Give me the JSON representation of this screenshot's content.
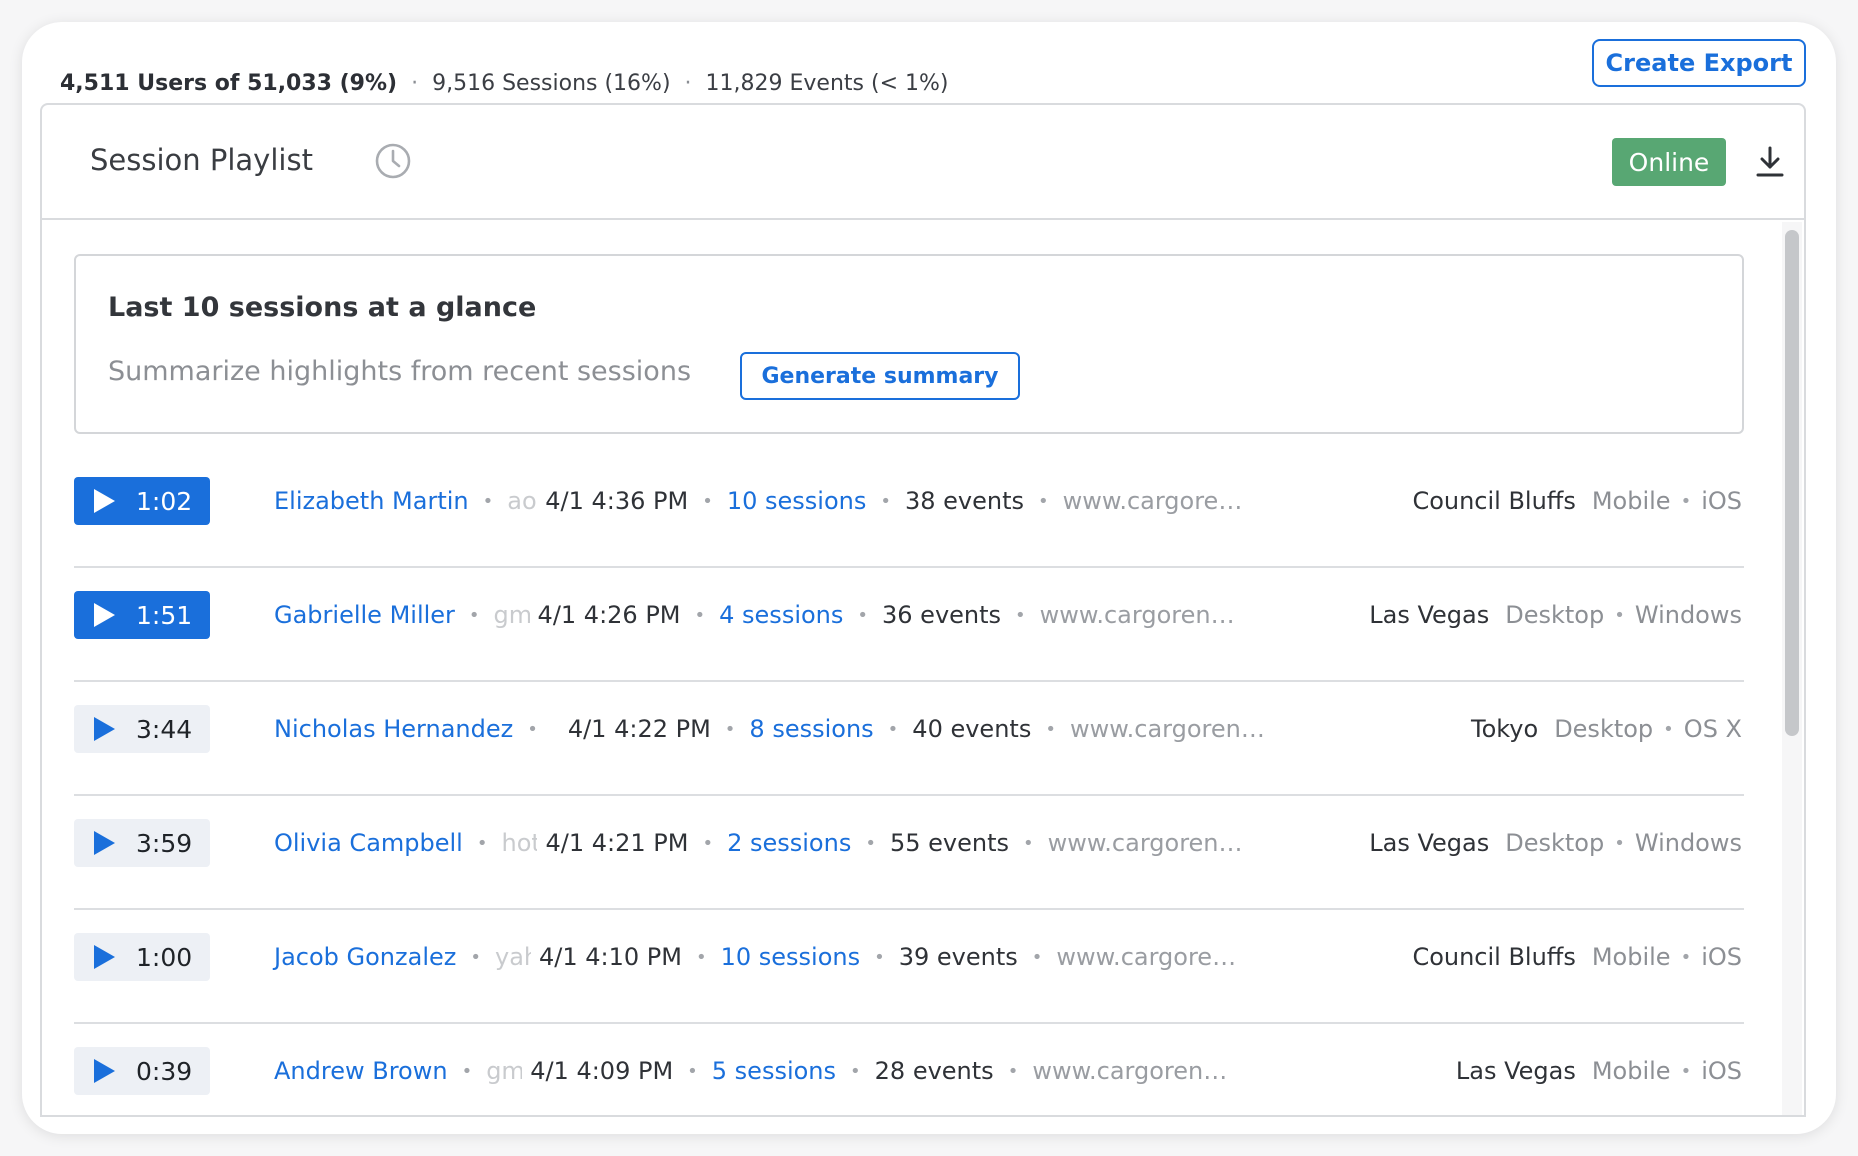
{
  "stats": {
    "users": "4,511 Users of 51,033 (9%)",
    "sessions": "9,516 Sessions (16%)",
    "events": "11,829 Events (< 1%)"
  },
  "toolbar": {
    "export_label": "Create Export"
  },
  "panel": {
    "title": "Session Playlist",
    "status": "Online",
    "status_color": "#58a773"
  },
  "summary": {
    "title": "Last 10 sessions at a glance",
    "description": "Summarize highlights from recent sessions",
    "button_label": "Generate summary"
  },
  "colors": {
    "accent": "#1a6fdb"
  },
  "icons": {
    "history": "clock-history-icon",
    "download": "download-icon",
    "play": "play-icon"
  },
  "sessions": [
    {
      "duration": "1:02",
      "user": "Elizabeth Martin",
      "email": "aol",
      "datetime": "4/1 4:36 PM",
      "sessions": "10 sessions",
      "events": "38 events",
      "url": "www.cargorent...",
      "city": "Council Bluffs",
      "device": "Mobile",
      "os": "iOS",
      "active": true
    },
    {
      "duration": "1:51",
      "user": "Gabrielle Miller",
      "email": "gmai",
      "datetime": "4/1 4:26 PM",
      "sessions": "4 sessions",
      "events": "36 events",
      "url": "www.cargorental...",
      "city": "Las Vegas",
      "device": "Desktop",
      "os": "Windows",
      "active": true
    },
    {
      "duration": "3:44",
      "user": "Nicholas Hernandez",
      "email": "",
      "datetime": "4/1 4:22 PM",
      "sessions": "8 sessions",
      "events": "40 events",
      "url": "www.cargorenta...",
      "city": "Tokyo",
      "device": "Desktop",
      "os": "OS X",
      "active": false
    },
    {
      "duration": "3:59",
      "user": "Olivia Campbell",
      "email": "hotr",
      "datetime": "4/1 4:21 PM",
      "sessions": "2 sessions",
      "events": "55 events",
      "url": "www.cargorental...",
      "city": "Las Vegas",
      "device": "Desktop",
      "os": "Windows",
      "active": false
    },
    {
      "duration": "1:00",
      "user": "Jacob Gonzalez",
      "email": "yah",
      "datetime": "4/1 4:10 PM",
      "sessions": "10 sessions",
      "events": "39 events",
      "url": "www.cargorent...",
      "city": "Council Bluffs",
      "device": "Mobile",
      "os": "iOS",
      "active": false
    },
    {
      "duration": "0:39",
      "user": "Andrew Brown",
      "email": "gmai",
      "datetime": "4/1 4:09 PM",
      "sessions": "5 sessions",
      "events": "28 events",
      "url": "www.cargorenta...",
      "city": "Las Vegas",
      "device": "Mobile",
      "os": "iOS",
      "active": false
    }
  ]
}
